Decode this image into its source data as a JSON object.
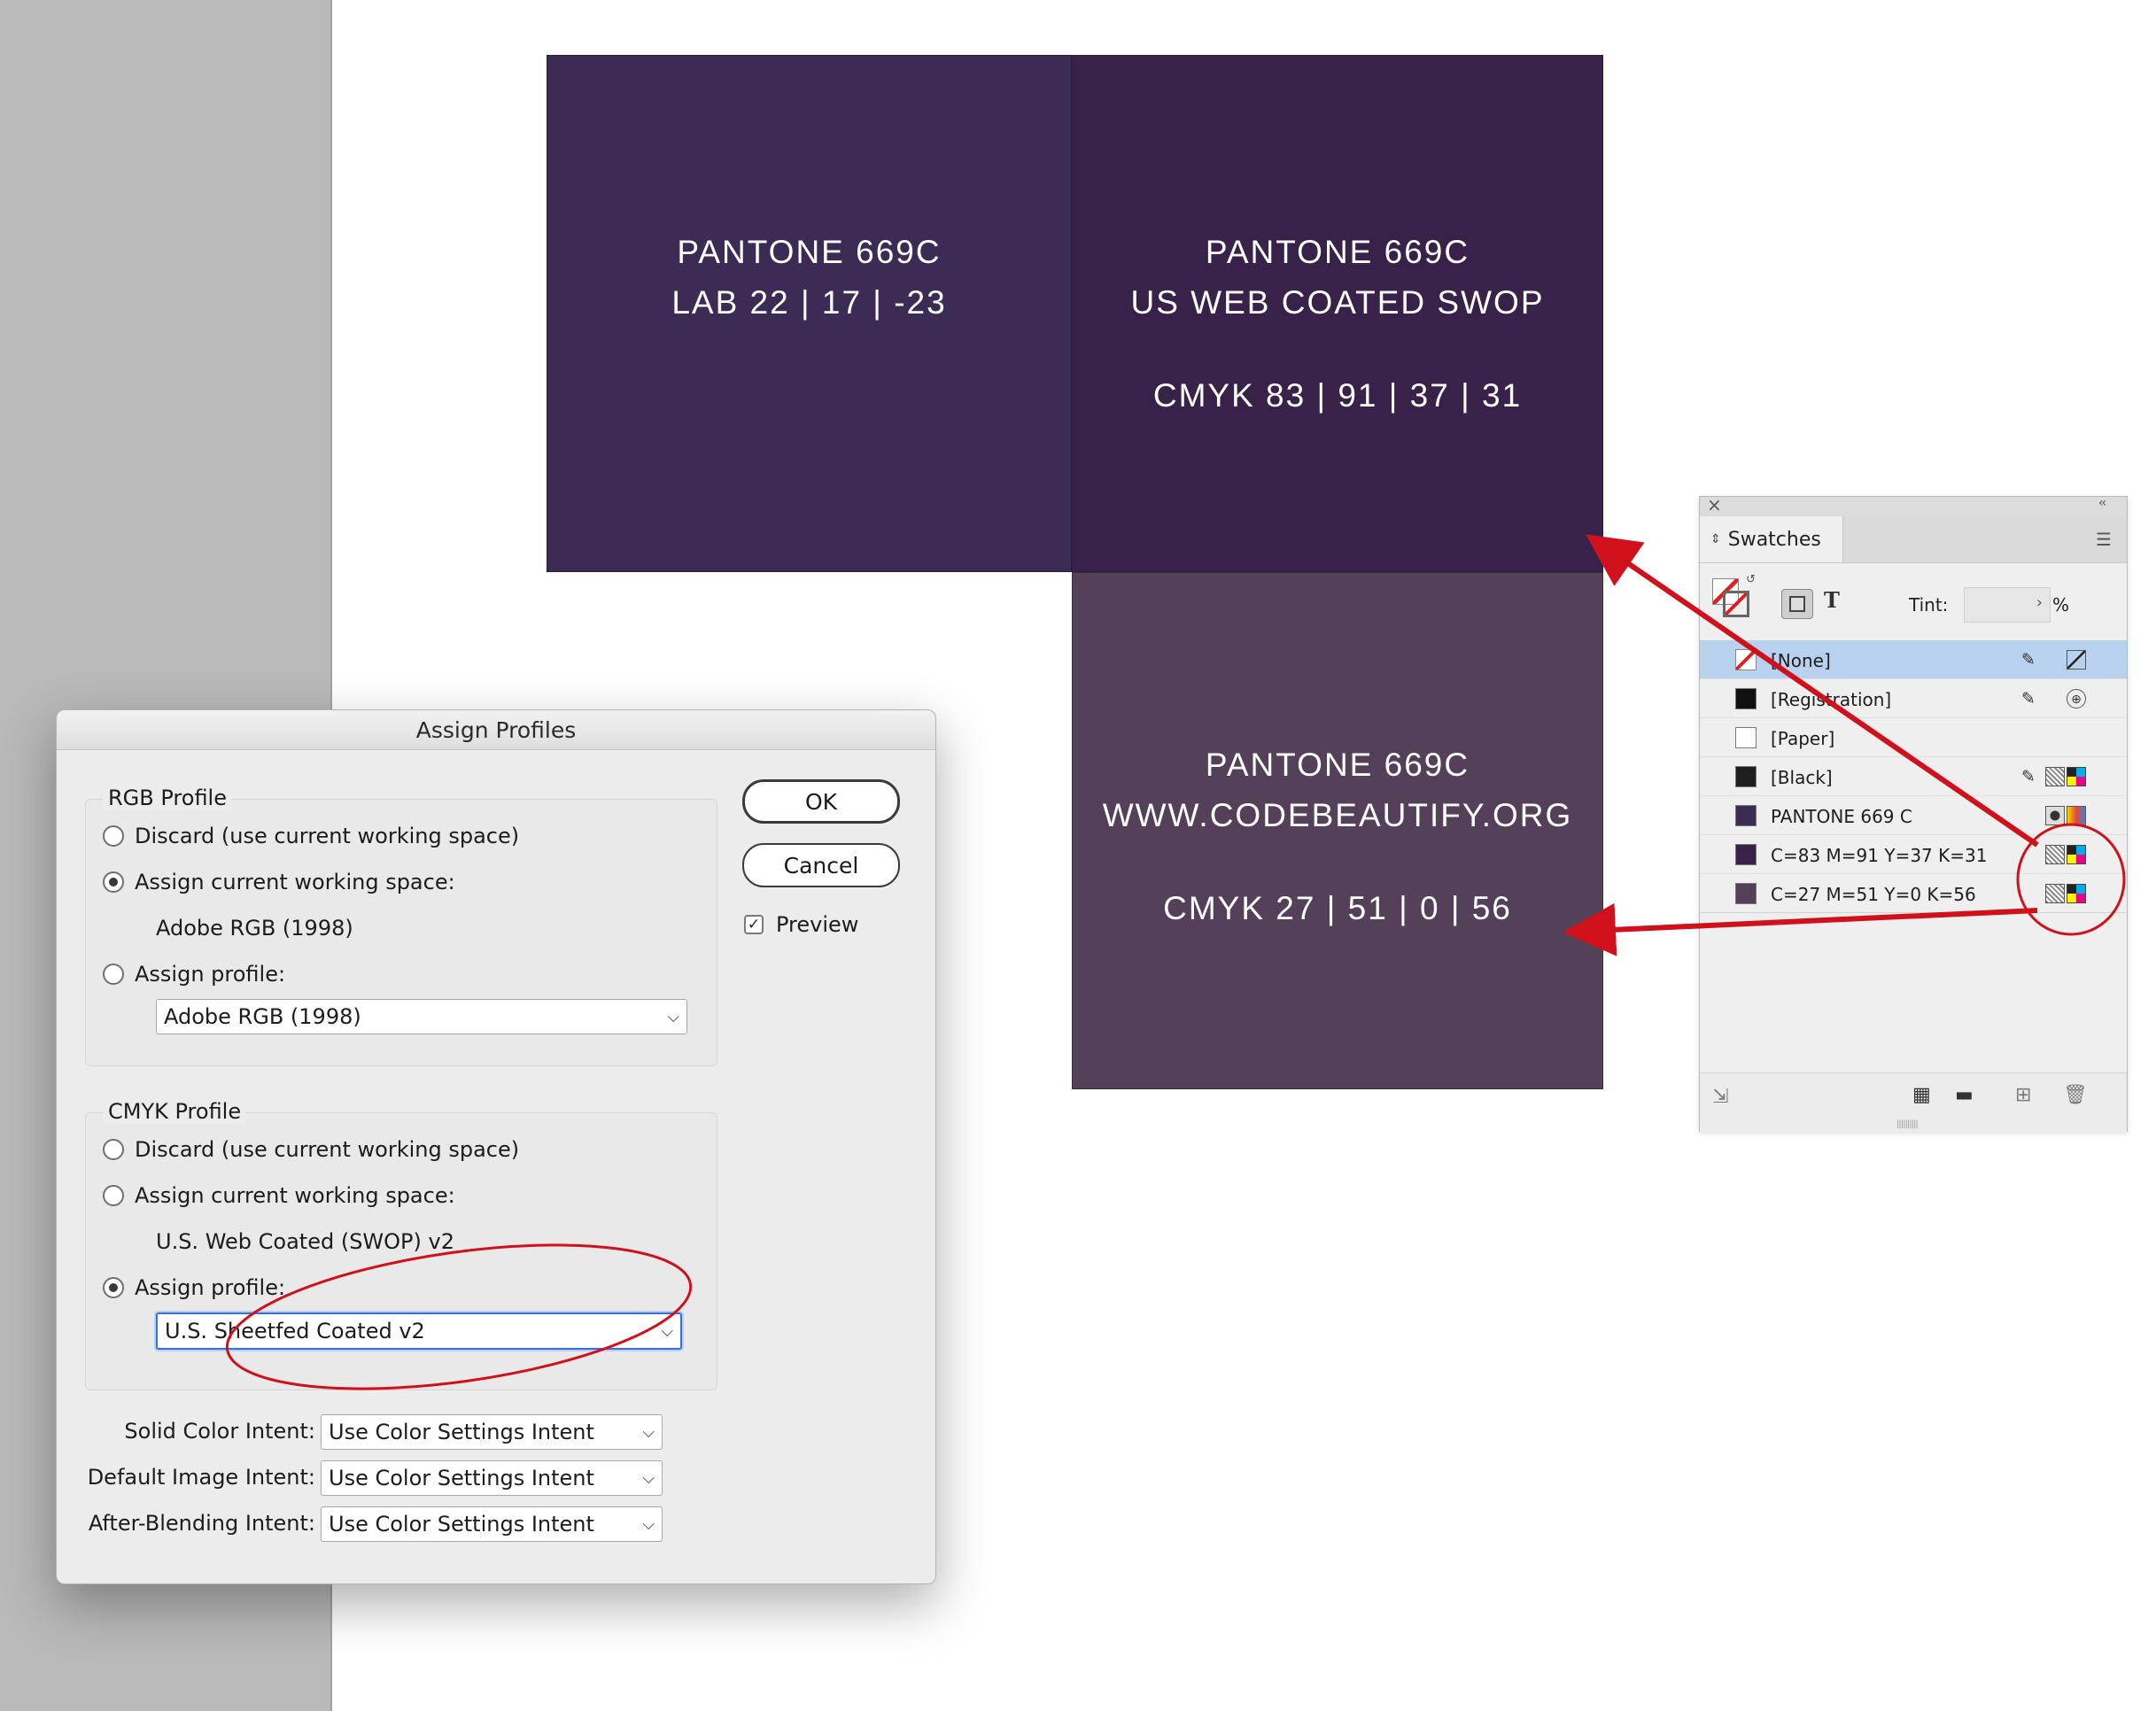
{
  "swatches_on_page": [
    {
      "lines": [
        "PANTONE 669C",
        "LAB 22 | 17 | -23"
      ]
    },
    {
      "lines": [
        "PANTONE 669C",
        "US WEB COATED SWOP",
        "CMYK 83 | 91 | 37 | 31"
      ]
    },
    {
      "lines": [
        "PANTONE 669C",
        "WWW.CODEBEAUTIFY.ORG",
        "CMYK 27 | 51 | 0 | 56"
      ]
    }
  ],
  "dialog": {
    "title": "Assign Profiles",
    "rgb": {
      "group_title": "RGB Profile",
      "discard_label": "Discard (use current working space)",
      "assign_current_label": "Assign current working space:",
      "current_space": "Adobe RGB (1998)",
      "assign_profile_label": "Assign profile:",
      "profile_value": "Adobe RGB (1998)",
      "selected": "assign_current"
    },
    "cmyk": {
      "group_title": "CMYK Profile",
      "discard_label": "Discard (use current working space)",
      "assign_current_label": "Assign current working space:",
      "current_space": "U.S. Web Coated (SWOP) v2",
      "assign_profile_label": "Assign profile:",
      "profile_value": "U.S. Sheetfed Coated v2",
      "selected": "assign_profile"
    },
    "ok_label": "OK",
    "cancel_label": "Cancel",
    "preview_label": "Preview",
    "preview_checked": true,
    "intents": [
      {
        "label": "Solid Color Intent:",
        "value": "Use Color Settings Intent"
      },
      {
        "label": "Default Image Intent:",
        "value": "Use Color Settings Intent"
      },
      {
        "label": "After-Blending Intent:",
        "value": "Use Color Settings Intent"
      }
    ]
  },
  "swatches_panel": {
    "tab_label": "Swatches",
    "tint_label": "Tint:",
    "tint_unit": "%",
    "type_icon": "T",
    "rows": [
      {
        "name": "[None]",
        "chip": "none",
        "selected": true,
        "icons": [
          "pencil-off-icon",
          "none-icon"
        ]
      },
      {
        "name": "[Registration]",
        "chip": "#111111",
        "icons": [
          "pencil-off-icon",
          "registration-icon"
        ]
      },
      {
        "name": "[Paper]",
        "chip": "#ffffff",
        "icons": []
      },
      {
        "name": "[Black]",
        "chip": "#1e1e1e",
        "icons": [
          "pencil-off-icon",
          "process-icon",
          "cmyk-icon"
        ]
      },
      {
        "name": "PANTONE 669 C",
        "chip": "#3c2b54",
        "icons": [
          "spot-icon",
          "lab-icon"
        ]
      },
      {
        "name": "C=83 M=91 Y=37 K=31",
        "chip": "#382249",
        "icons": [
          "process-icon",
          "cmyk-icon"
        ]
      },
      {
        "name": "C=27 M=51 Y=0 K=56",
        "chip": "#554059",
        "icons": [
          "process-icon",
          "cmyk-icon"
        ]
      }
    ]
  },
  "colors": {
    "annotation_red": "#d0101a",
    "lab_swatch": "#3c2b54",
    "swop_swatch": "#382249",
    "sheetfed_swatch": "#554059",
    "selection_blue": "#b7d1ef"
  }
}
